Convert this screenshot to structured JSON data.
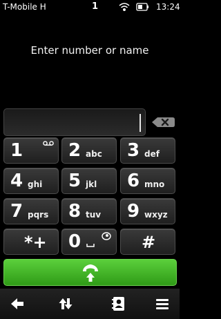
{
  "status_bar": {
    "operator": "T-Mobile H",
    "notification_count": "1",
    "time": "13:24",
    "icons": [
      "wifi-icon",
      "battery-icon"
    ]
  },
  "dialer": {
    "prompt": "Enter number or name",
    "field_value": "",
    "keys": [
      {
        "digit": "1",
        "letters": ""
      },
      {
        "digit": "2",
        "letters": "abc"
      },
      {
        "digit": "3",
        "letters": "def"
      },
      {
        "digit": "4",
        "letters": "ghi"
      },
      {
        "digit": "5",
        "letters": "jkl"
      },
      {
        "digit": "6",
        "letters": "mno"
      },
      {
        "digit": "7",
        "letters": "pqrs"
      },
      {
        "digit": "8",
        "letters": "tuv"
      },
      {
        "digit": "9",
        "letters": "wxyz"
      },
      {
        "digit": "*+",
        "letters": ""
      },
      {
        "digit": "0",
        "letters": ""
      },
      {
        "digit": "#",
        "letters": ""
      }
    ],
    "call_color": "#3fb822"
  },
  "toolbar": {
    "items": [
      "back-arrow-icon",
      "call-log-icon",
      "contacts-icon",
      "menu-icon"
    ]
  }
}
